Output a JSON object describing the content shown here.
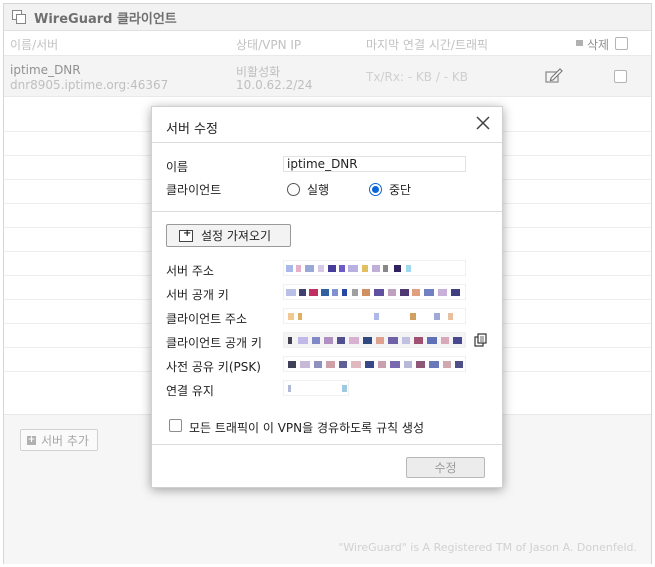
{
  "window": {
    "title": "WireGuard 클라이언트"
  },
  "columns": {
    "name": "이름/서버",
    "status": "상태/VPN IP",
    "last": "마지막 연결 시간/트래픽",
    "delete": "삭제"
  },
  "client_row": {
    "name": "iptime_DNR",
    "server": "dnr8905.iptime.org:46367",
    "status": "비활성화",
    "vpn_ip": "10.0.62.2/24",
    "traffic": "Tx/Rx: - KB / - KB",
    "edit_icon": "edit-icon"
  },
  "footer": {
    "add_server": "서버 추가",
    "trademark": "\"WireGuard\" is A Registered TM of Jason A. Donenfeld."
  },
  "dialog": {
    "title": "서버 수정",
    "name_label": "이름",
    "name_value": "iptime_DNR",
    "client_label": "클라이언트",
    "radio_run": "실행",
    "radio_stop": "중단",
    "radio_selected": "중단",
    "import_button": "설정 가져오기",
    "fields": {
      "server_address": "서버 주소",
      "server_public_key": "서버 공개 키",
      "client_address": "클라이언트 주소",
      "client_public_key": "클라이언트 공개 키",
      "psk": "사전 공유 키(PSK)",
      "keepalive": "연결 유지"
    },
    "route_all_label": "모든 트래픽이 이 VPN을 경유하도록 규칙 생성",
    "save_button": "수정"
  },
  "colors": {
    "accent": "#0a66d8",
    "row_bg": "#eeeeee",
    "title_bg": "#ececec"
  }
}
